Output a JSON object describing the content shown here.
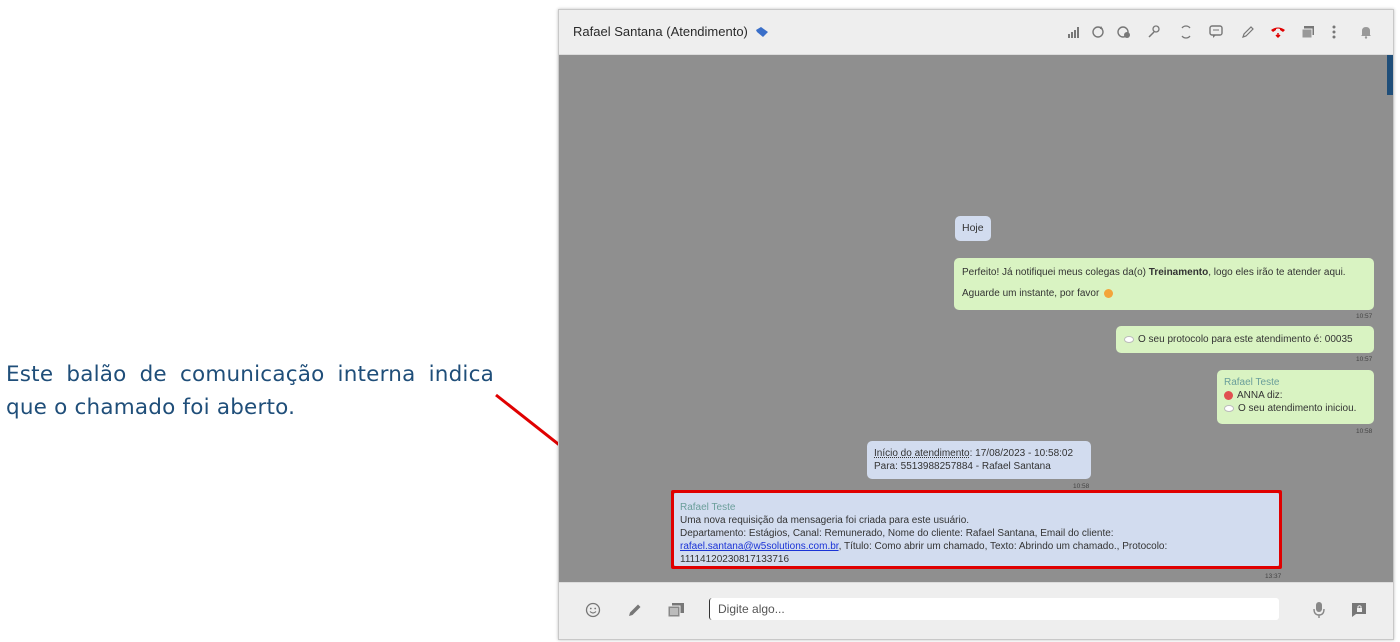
{
  "annotation": {
    "text": "Este balão de comunicação interna indica que o chamado foi aberto."
  },
  "header": {
    "title": "Rafael Santana (Atendimento)",
    "icons": [
      "signal-icon",
      "refresh-icon",
      "timer-icon",
      "pin-icon",
      "transfer-icon",
      "chat-icon",
      "pencil-icon",
      "hangup-icon",
      "gallery-icon",
      "more-icon",
      "bell-icon"
    ],
    "accent": "#3a6fc9",
    "hangup_color": "#e00000"
  },
  "chat": {
    "date_label": "Hoje",
    "messages": [
      {
        "line1_pre": "Perfeito! Já notifiquei meus colegas da(o) ",
        "line1_bold": "Treinamento",
        "line1_post": ", logo eles irão te atender aqui.",
        "line2": "Aguarde um instante, por favor",
        "time": "10:57"
      },
      {
        "text": "O seu protocolo para este atendimento é: 00035",
        "time": "10:57"
      },
      {
        "sender": "Rafael Teste",
        "line1": "ANNA diz:",
        "line2": "O seu atendimento iniciou.",
        "time": "10:58"
      },
      {
        "line1_label": "Início do atendimento",
        "line1_value": ": 17/08/2023 - 10:58:02",
        "line2": "Para: 5513988257884 - Rafael Santana",
        "time": "10:58"
      },
      {
        "sender": "Rafael Teste",
        "line1": "Uma nova requisição da mensageria foi criada para este usuário.",
        "line2": "Departamento: Estágios, Canal: Remunerado, Nome do cliente: Rafael Santana, Email do cliente:",
        "link": "rafael.santana@w5solutions.com.br",
        "line3_post": ", Título: Como abrir um chamado, Texto: Abrindo um chamado., Protocolo:",
        "line4": "11114120230817133716",
        "time": "13:37"
      }
    ]
  },
  "footer": {
    "placeholder": "Digite algo..."
  },
  "colors": {
    "chat_bg": "#8f8f8f",
    "green_bubble": "#d9f3c2",
    "blue_bubble": "#d2dcef",
    "highlight": "#e00000"
  }
}
